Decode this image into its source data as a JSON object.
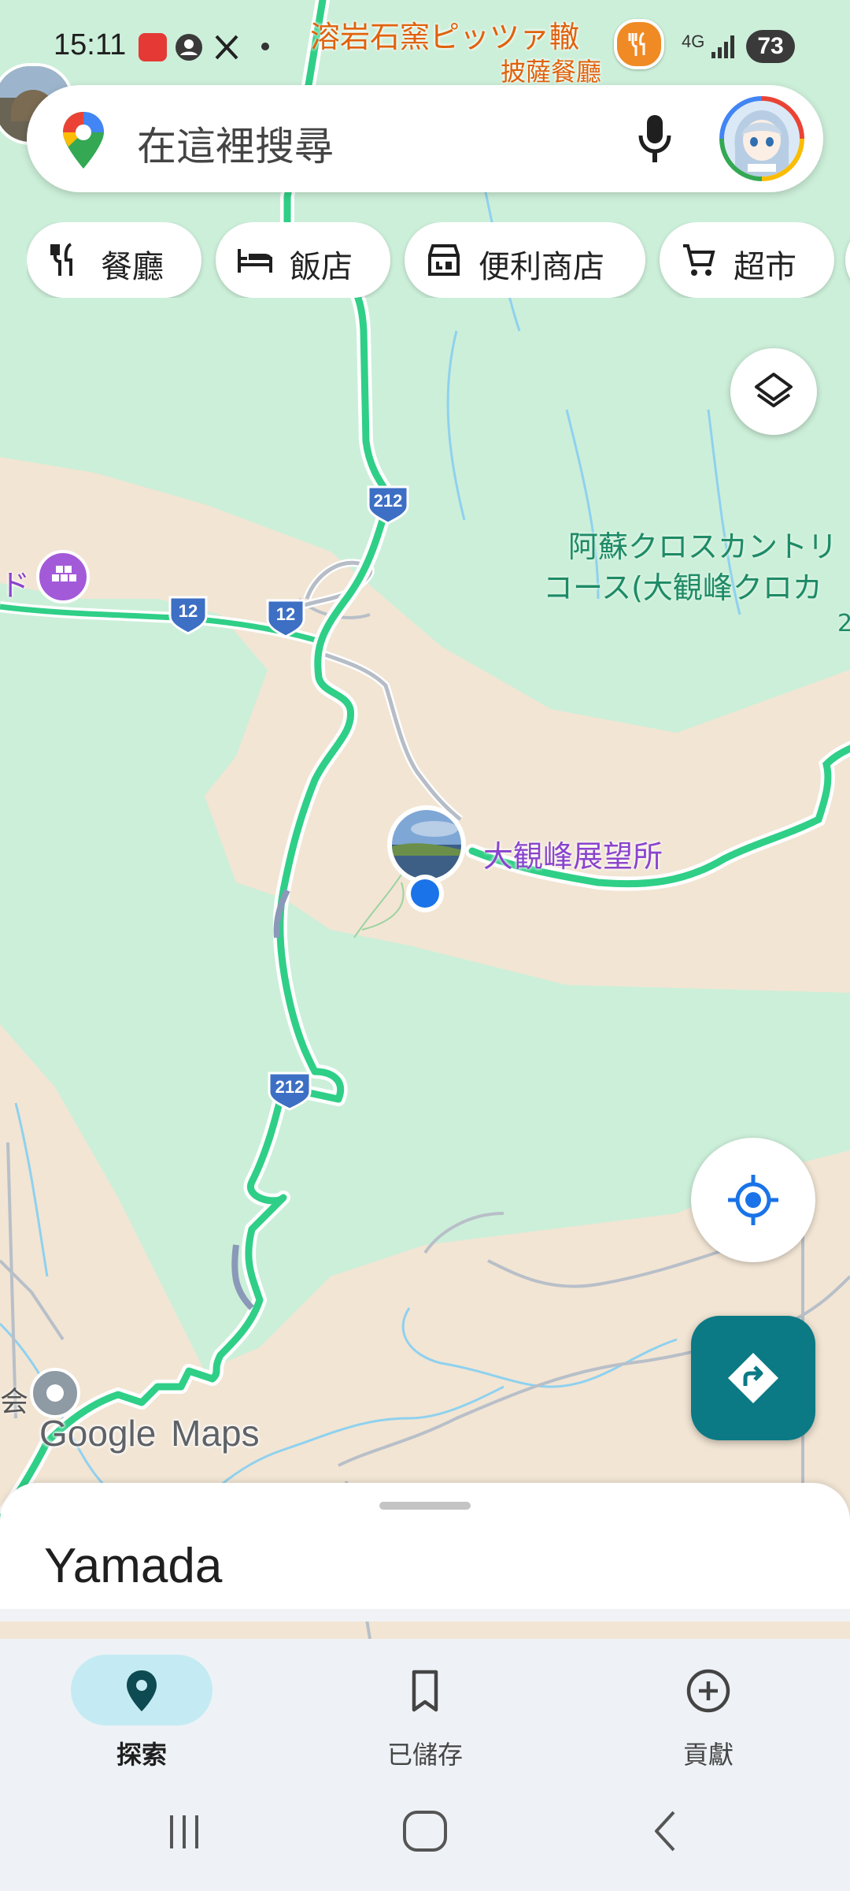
{
  "status_bar": {
    "time": "15:11",
    "network": "4G",
    "battery": "73",
    "icons": [
      "fct-app-icon",
      "account-circle-icon",
      "x-app-icon",
      "dot-icon",
      "signal-icon"
    ]
  },
  "search": {
    "placeholder": "在這裡搜尋",
    "icons": [
      "google-maps-pin-icon",
      "microphone-icon",
      "profile-avatar"
    ]
  },
  "chips": [
    {
      "label": "餐廳",
      "icon": "restaurant-icon"
    },
    {
      "label": "飯店",
      "icon": "hotel-icon"
    },
    {
      "label": "便利商店",
      "icon": "convenience-store-icon"
    },
    {
      "label": "超市",
      "icon": "shopping-cart-icon"
    }
  ],
  "map": {
    "labels": {
      "restaurant_name": "溶岩石窯ピッツァ轍",
      "restaurant_category": "披薩餐廳",
      "park_line1": "阿蘇クロスカントリ",
      "park_line2": "コース(大観峰クロカ",
      "viewpoint": "大観峰展望所",
      "left_edge_text": "ド",
      "left_edge_text2": "会"
    },
    "route_shields": [
      "212",
      "12",
      "12",
      "212"
    ],
    "attribution": {
      "google": "Google",
      "maps": "Maps"
    },
    "colors": {
      "forest": "#ccefd9",
      "terrain": "#f2e5d4",
      "highway": "#2fcf87",
      "river": "#8fd1ef",
      "shield": "#3d6fc4",
      "location_dot": "#1a73e8"
    }
  },
  "buttons": {
    "layers": "layers-icon",
    "my_location": "my-location-icon",
    "directions": "directions-icon"
  },
  "bottom_sheet": {
    "title": "Yamada"
  },
  "bottom_nav": {
    "items": [
      {
        "label": "探索",
        "icon": "explore-pin-icon",
        "active": true
      },
      {
        "label": "已儲存",
        "icon": "bookmark-icon",
        "active": false
      },
      {
        "label": "貢獻",
        "icon": "add-circle-icon",
        "active": false
      }
    ]
  },
  "system_nav": [
    "recent-apps-icon",
    "home-icon",
    "back-icon"
  ]
}
